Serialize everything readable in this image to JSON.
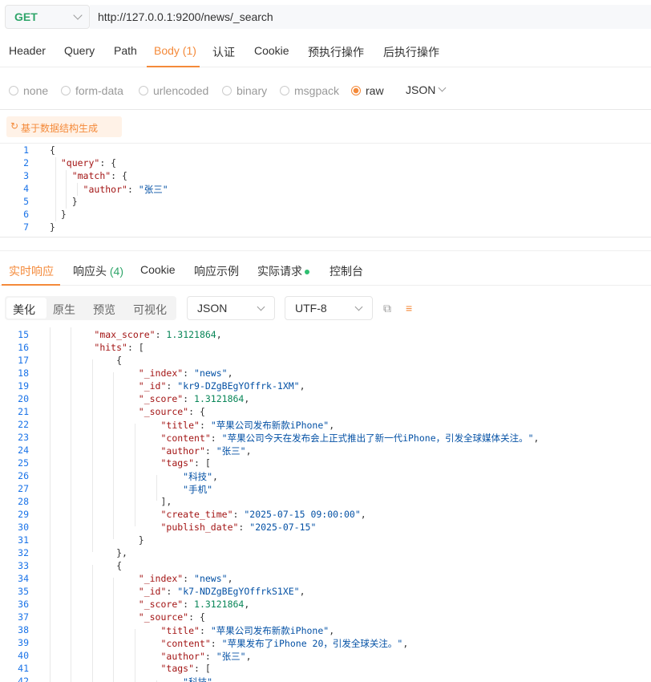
{
  "request": {
    "method": "GET",
    "url": "http://127.0.0.1:9200/news/_search"
  },
  "request_tabs": [
    "Header",
    "Query",
    "Path",
    "Body (1)",
    "认证",
    "Cookie",
    "预执行操作",
    "后执行操作"
  ],
  "body_types": [
    "none",
    "form-data",
    "urlencoded",
    "binary",
    "msgpack",
    "raw"
  ],
  "body_format": "JSON",
  "generate_button": "基于数据结构生成",
  "request_body": [
    {
      "n": "1",
      "t": "{"
    },
    {
      "n": "2",
      "t": "  \"query\": {"
    },
    {
      "n": "3",
      "t": "    \"match\": {"
    },
    {
      "n": "4",
      "t": "      \"author\": \"张三\""
    },
    {
      "n": "5",
      "t": "    }"
    },
    {
      "n": "6",
      "t": "  }"
    },
    {
      "n": "7",
      "t": "}"
    }
  ],
  "response_tabs": {
    "realtime": "实时响应",
    "headers": "响应头",
    "headers_count": "(4)",
    "cookie": "Cookie",
    "example": "响应示例",
    "actual": "实际请求",
    "console": "控制台"
  },
  "view_modes": [
    "美化",
    "原生",
    "预览",
    "可视化"
  ],
  "response_format": "JSON",
  "encoding": "UTF-8",
  "response_body": [
    {
      "n": "15",
      "t": "        \"max_score\": 1.3121864,"
    },
    {
      "n": "16",
      "t": "        \"hits\": ["
    },
    {
      "n": "17",
      "t": "            {"
    },
    {
      "n": "18",
      "t": "                \"_index\": \"news\","
    },
    {
      "n": "19",
      "t": "                \"_id\": \"kr9-DZgBEgYOffrk-1XM\","
    },
    {
      "n": "20",
      "t": "                \"_score\": 1.3121864,"
    },
    {
      "n": "21",
      "t": "                \"_source\": {"
    },
    {
      "n": "22",
      "t": "                    \"title\": \"苹果公司发布新款iPhone\","
    },
    {
      "n": "23",
      "t": "                    \"content\": \"苹果公司今天在发布会上正式推出了新一代iPhone，引发全球媒体关注。\","
    },
    {
      "n": "24",
      "t": "                    \"author\": \"张三\","
    },
    {
      "n": "25",
      "t": "                    \"tags\": ["
    },
    {
      "n": "26",
      "t": "                        \"科技\","
    },
    {
      "n": "27",
      "t": "                        \"手机\""
    },
    {
      "n": "28",
      "t": "                    ],"
    },
    {
      "n": "29",
      "t": "                    \"create_time\": \"2025-07-15 09:00:00\","
    },
    {
      "n": "30",
      "t": "                    \"publish_date\": \"2025-07-15\""
    },
    {
      "n": "31",
      "t": "                }"
    },
    {
      "n": "32",
      "t": "            },"
    },
    {
      "n": "33",
      "t": "            {"
    },
    {
      "n": "34",
      "t": "                \"_index\": \"news\","
    },
    {
      "n": "35",
      "t": "                \"_id\": \"k7-NDZgBEgYOffrkS1XE\","
    },
    {
      "n": "36",
      "t": "                \"_score\": 1.3121864,"
    },
    {
      "n": "37",
      "t": "                \"_source\": {"
    },
    {
      "n": "38",
      "t": "                    \"title\": \"苹果公司发布新款iPhone\","
    },
    {
      "n": "39",
      "t": "                    \"content\": \"苹果发布了iPhone 20，引发全球关注。\","
    },
    {
      "n": "40",
      "t": "                    \"author\": \"张三\","
    },
    {
      "n": "41",
      "t": "                    \"tags\": ["
    },
    {
      "n": "42",
      "t": "                        \"科技\","
    }
  ]
}
